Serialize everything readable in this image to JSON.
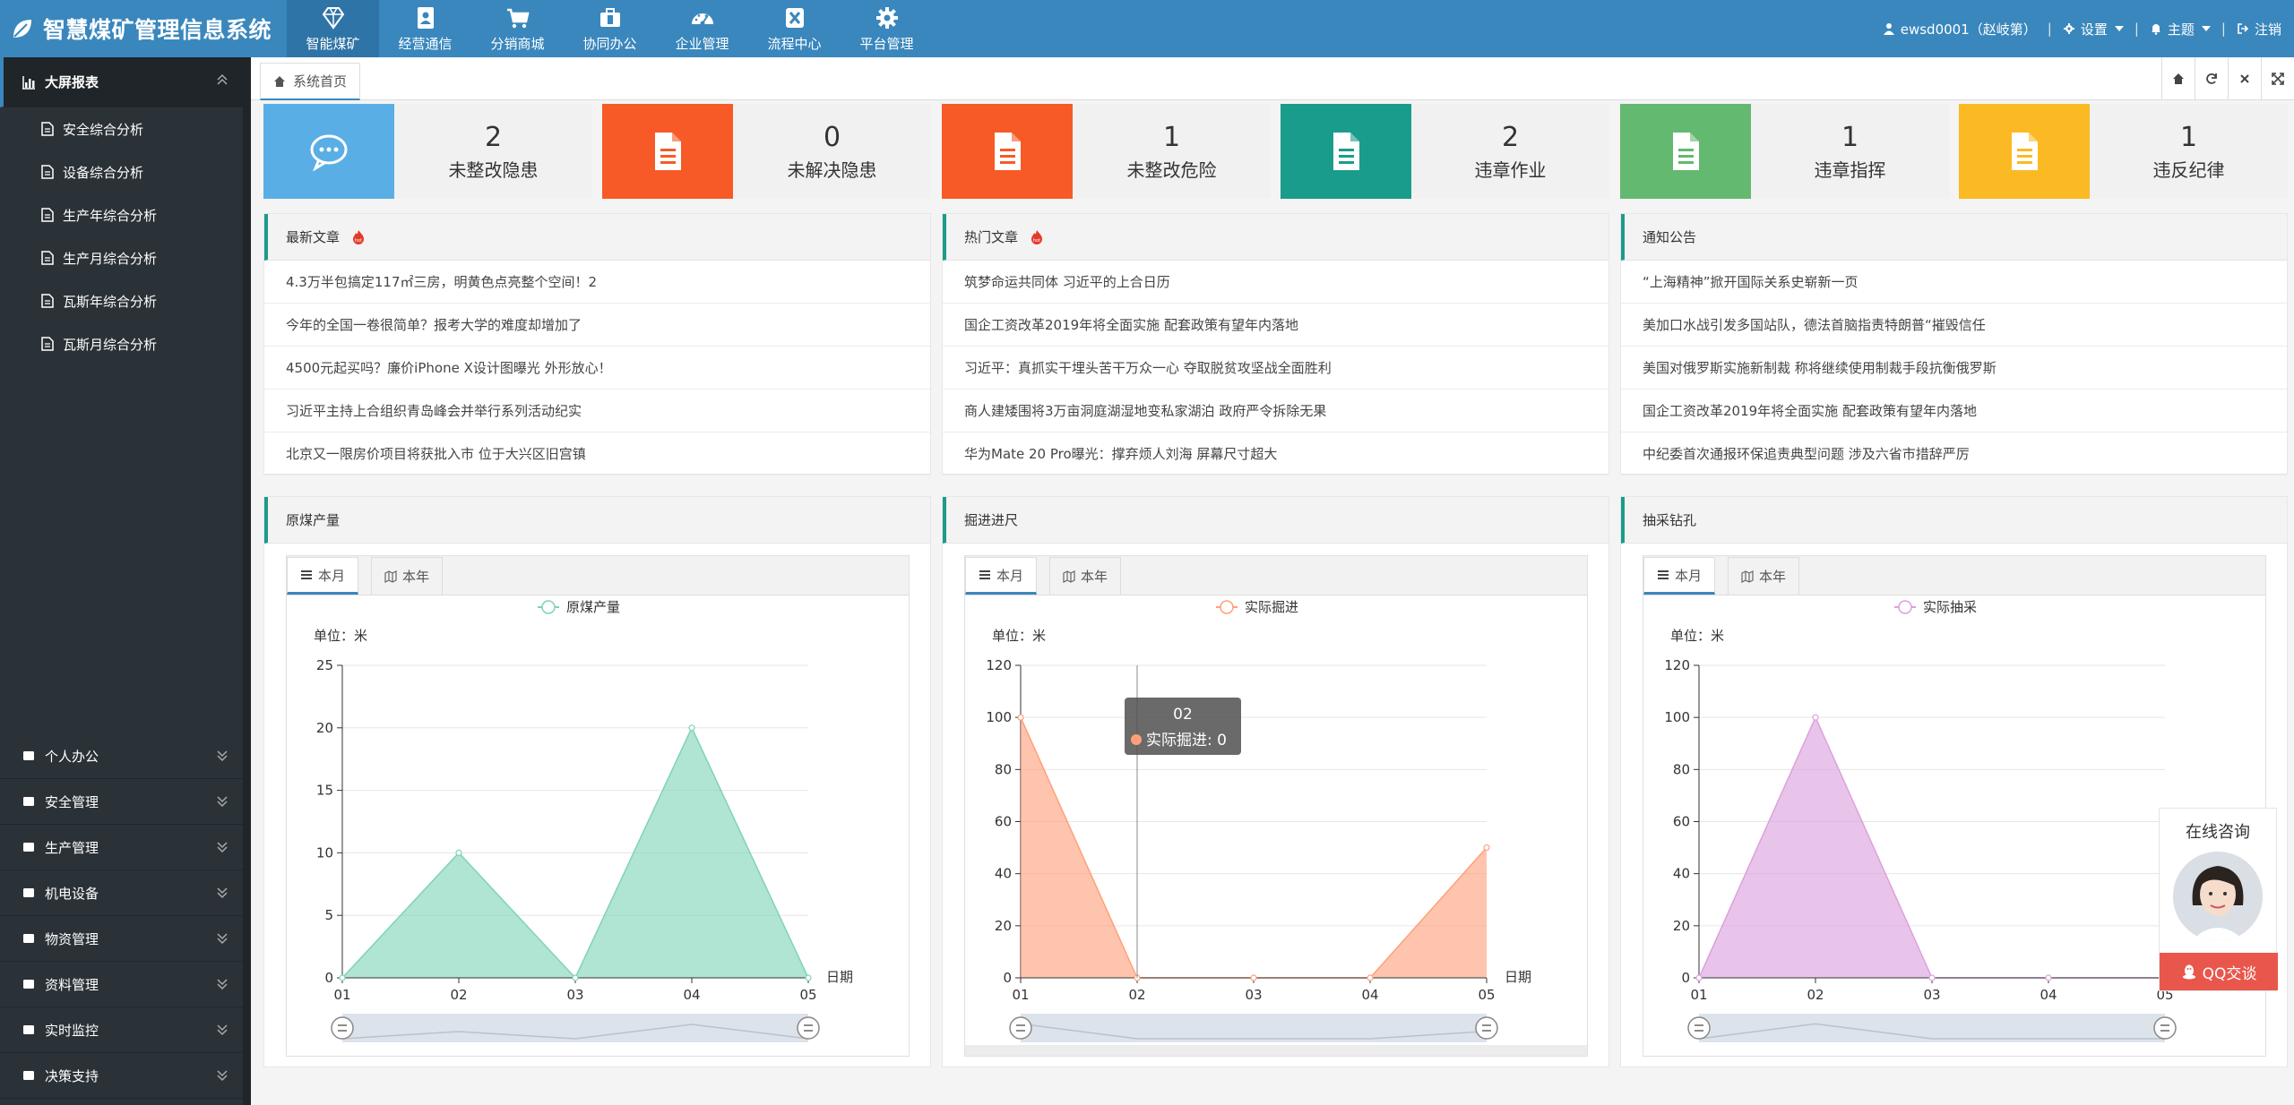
{
  "app": {
    "title": "智慧煤矿管理信息系统"
  },
  "nav": [
    {
      "label": "智能煤矿",
      "icon": "diamond-icon"
    },
    {
      "label": "经营通信",
      "icon": "contact-card-icon"
    },
    {
      "label": "分销商城",
      "icon": "cart-icon"
    },
    {
      "label": "协同办公",
      "icon": "briefcase-icon"
    },
    {
      "label": "企业管理",
      "icon": "dashboard-icon"
    },
    {
      "label": "流程中心",
      "icon": "x-square-icon"
    },
    {
      "label": "平台管理",
      "icon": "gear-icon"
    }
  ],
  "user": {
    "name": "ewsd0001（赵岐第）",
    "settings": "设置",
    "theme": "主题",
    "logout": "注销"
  },
  "sidebar": {
    "dashboard": {
      "label": "大屏报表",
      "items": [
        "安全综合分析",
        "设备综合分析",
        "生产年综合分析",
        "生产月综合分析",
        "瓦斯年综合分析",
        "瓦斯月综合分析"
      ]
    },
    "groups": [
      "个人办公",
      "安全管理",
      "生产管理",
      "机电设备",
      "物资管理",
      "资料管理",
      "实时监控",
      "决策支持"
    ]
  },
  "tabs": {
    "home": "系统首页"
  },
  "stats": [
    {
      "value": "2",
      "label": "未整改隐患",
      "color": "#5aaee6",
      "icon": "chat-bubble-icon"
    },
    {
      "value": "0",
      "label": "未解决隐患",
      "color": "#f75a27",
      "icon": "document-icon"
    },
    {
      "value": "1",
      "label": "未整改危险",
      "color": "#f75a27",
      "icon": "document-icon"
    },
    {
      "value": "2",
      "label": "违章作业",
      "color": "#1a9c8c",
      "icon": "document-icon"
    },
    {
      "value": "1",
      "label": "违章指挥",
      "color": "#62b96f",
      "icon": "document-icon"
    },
    {
      "value": "1",
      "label": "违反纪律",
      "color": "#fbb924",
      "icon": "document-icon"
    }
  ],
  "latest": {
    "title": "最新文章",
    "items": [
      "4.3万半包搞定117㎡三房，明黄色点亮整个空间！2",
      "今年的全国一卷很简单？报考大学的难度却增加了",
      "4500元起买吗？廉价iPhone X设计图曝光 外形放心！",
      "习近平主持上合组织青岛峰会并举行系列活动纪实",
      "北京又一限房价项目将获批入市 位于大兴区旧宫镇"
    ]
  },
  "hot": {
    "title": "热门文章",
    "items": [
      "筑梦命运共同体 习近平的上合日历",
      "国企工资改革2019年将全面实施 配套政策有望年内落地",
      "习近平：真抓实干埋头苦干万众一心 夺取脱贫攻坚战全面胜利",
      "商人建矮围将3万亩洞庭湖湿地变私家湖泊 政府严令拆除无果",
      "华为Mate 20 Pro曝光：撑弃烦人刘海 屏幕尺寸超大"
    ]
  },
  "notice": {
    "title": "通知公告",
    "items": [
      "“上海精神”掀开国际关系史崭新一页",
      "美加口水战引发多国站队，德法首脑指责特朗普“摧毁信任",
      "美国对俄罗斯实施新制裁 称将继续使用制裁手段抗衡俄罗斯",
      "国企工资改革2019年将全面实施 配套政策有望年内落地",
      "中纪委首次通报环保追责典型问题 涉及六省市措辞严厉"
    ]
  },
  "chart_tabs": {
    "month": "本月",
    "year": "本年"
  },
  "chart_data": [
    {
      "type": "area",
      "panel_title": "原煤产量",
      "unit_label": "单位：米",
      "xlabel": "日期",
      "x": [
        "01",
        "02",
        "03",
        "04",
        "05"
      ],
      "series": [
        {
          "name": "原煤产量",
          "values": [
            0,
            10,
            0,
            20,
            0
          ]
        }
      ],
      "ylim": [
        0,
        25
      ],
      "yticks": [
        0,
        5,
        10,
        15,
        20,
        25
      ],
      "color": "#7fd3b8",
      "legend": "top-center"
    },
    {
      "type": "area",
      "panel_title": "掘进进尺",
      "unit_label": "单位：米",
      "xlabel": "日期",
      "x": [
        "01",
        "02",
        "03",
        "04",
        "05"
      ],
      "series": [
        {
          "name": "实际掘进",
          "values": [
            100,
            0,
            0,
            0,
            50
          ]
        }
      ],
      "ylim": [
        0,
        120
      ],
      "yticks": [
        0,
        20,
        40,
        60,
        80,
        100,
        120
      ],
      "color": "#ffa07a",
      "legend": "top-center",
      "tooltip": {
        "title": "02",
        "text": "实际掘进: 0"
      }
    },
    {
      "type": "area",
      "panel_title": "抽采钻孔",
      "unit_label": "单位：米",
      "xlabel": "",
      "x": [
        "01",
        "02",
        "03",
        "04",
        "05"
      ],
      "series": [
        {
          "name": "实际抽采",
          "values": [
            0,
            100,
            0,
            0,
            0
          ]
        }
      ],
      "ylim": [
        0,
        120
      ],
      "yticks": [
        0,
        20,
        40,
        60,
        80,
        100,
        120
      ],
      "color": "#dca0dd",
      "legend": "top-center"
    }
  ],
  "consult": {
    "title": "在线咨询",
    "button": "QQ交谈"
  }
}
